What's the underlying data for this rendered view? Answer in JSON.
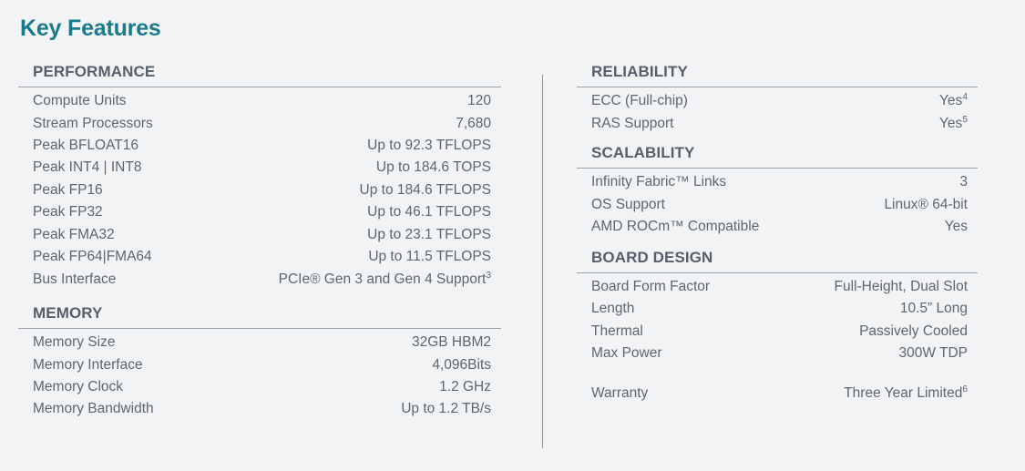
{
  "page": {
    "title": "Key Features",
    "accent_color": "#1a7b8c",
    "text_color": "#5f666e",
    "heading_color": "#57606a",
    "background_color": "#f2f3f4",
    "rule_color": "#9aa0a6",
    "divider_color": "#8a9098"
  },
  "left_column": {
    "sections": [
      {
        "title": "PERFORMANCE",
        "rows": [
          {
            "label": "Compute Units",
            "value": "120"
          },
          {
            "label": "Stream Processors",
            "value": "7,680"
          },
          {
            "label": "Peak BFLOAT16",
            "value": "Up to 92.3 TFLOPS"
          },
          {
            "label": "Peak INT4 | INT8",
            "value": "Up to 184.6 TOPS"
          },
          {
            "label": "Peak FP16",
            "value": "Up to 184.6 TFLOPS"
          },
          {
            "label": "Peak FP32",
            "value": "Up to 46.1 TFLOPS"
          },
          {
            "label": "Peak FMA32",
            "value": "Up to 23.1 TFLOPS"
          },
          {
            "label": "Peak FP64|FMA64",
            "value": "Up to 11.5 TFLOPS"
          },
          {
            "label": "Bus Interface",
            "value": "PCIe® Gen 3 and Gen 4 Support",
            "footnote": "3"
          }
        ]
      },
      {
        "title": "MEMORY",
        "rows": [
          {
            "label": "Memory Size",
            "value": "32GB HBM2"
          },
          {
            "label": "Memory Interface",
            "value": "4,096Bits"
          },
          {
            "label": "Memory Clock",
            "value": "1.2 GHz"
          },
          {
            "label": "Memory Bandwidth",
            "value": "Up to 1.2 TB/s"
          }
        ]
      }
    ]
  },
  "right_column": {
    "sections": [
      {
        "title": "RELIABILITY",
        "rows": [
          {
            "label": "ECC (Full-chip)",
            "value": "Yes",
            "footnote": "4"
          },
          {
            "label": "RAS Support",
            "value": "Yes",
            "footnote": "5"
          }
        ]
      },
      {
        "title": "SCALABILITY",
        "rows": [
          {
            "label": "Infinity Fabric™ Links",
            "value": "3"
          },
          {
            "label": "OS Support",
            "value": "Linux® 64-bit"
          },
          {
            "label": "AMD ROCm™ Compatible",
            "value": "Yes"
          }
        ]
      },
      {
        "title": "BOARD DESIGN",
        "rows": [
          {
            "label": "Board Form Factor",
            "value": "Full-Height, Dual Slot"
          },
          {
            "label": "Length",
            "value": "10.5” Long"
          },
          {
            "label": "Thermal",
            "value": "Passively Cooled"
          },
          {
            "label": "Max Power",
            "value": "300W TDP"
          }
        ]
      }
    ],
    "warranty": {
      "label": "Warranty",
      "value": "Three Year Limited",
      "footnote": "6"
    }
  }
}
